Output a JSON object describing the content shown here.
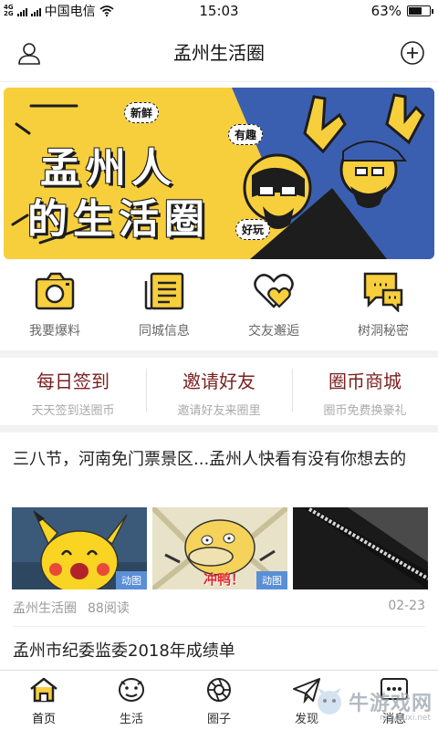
{
  "status_bar": {
    "network_top": "4G",
    "network_bottom": "2G",
    "carrier": "中国电信",
    "time": "15:03",
    "battery_text": "63%",
    "battery_level": 0.63
  },
  "header": {
    "title": "孟州生活圈",
    "left_icon": "user-icon",
    "right_icon": "plus-circle-icon"
  },
  "banner": {
    "line1": "孟州人",
    "line2": "的生活圈",
    "tags": [
      "新鲜",
      "有趣",
      "好玩"
    ],
    "colors": {
      "yellow": "#f7cf3d",
      "blue": "#3b5fb0",
      "dark": "#1d1d1d"
    }
  },
  "features": [
    {
      "label": "我要爆料",
      "icon": "camera-icon"
    },
    {
      "label": "同城信息",
      "icon": "document-icon"
    },
    {
      "label": "交友邂逅",
      "icon": "hearts-icon"
    },
    {
      "label": "树洞秘密",
      "icon": "chat-bubbles-icon"
    }
  ],
  "actions": [
    {
      "title": "每日签到",
      "subtitle": "天天签到送圈币"
    },
    {
      "title": "邀请好友",
      "subtitle": "邀请好友来圈里"
    },
    {
      "title": "圈币商城",
      "subtitle": "圈币免费换豪礼"
    }
  ],
  "feed": [
    {
      "title": "三八节，河南免门票景区...孟州人快看有没有你想去的",
      "thumbnails": [
        {
          "badge": "动图",
          "caption": ""
        },
        {
          "badge": "动图",
          "caption": "冲鸭！"
        },
        {
          "badge": "",
          "caption": ""
        }
      ],
      "source": "孟州生活圈",
      "reads": "88阅读",
      "date": "02-23"
    },
    {
      "title": "孟州市纪委监委2018年成绩单"
    }
  ],
  "tabbar": [
    {
      "label": "首页",
      "icon": "home-icon",
      "active": true
    },
    {
      "label": "生活",
      "icon": "mascot-icon",
      "active": false
    },
    {
      "label": "圈子",
      "icon": "aperture-icon",
      "active": false
    },
    {
      "label": "发现",
      "icon": "paper-plane-icon",
      "active": false
    },
    {
      "label": "消息",
      "icon": "message-icon",
      "active": false
    }
  ],
  "watermark": {
    "text": "牛游戏网",
    "url": "niuyouxi.net"
  },
  "theme": {
    "accent": "#f7cf3d",
    "accent_dark": "#7a1f1f",
    "muted": "#999999"
  }
}
